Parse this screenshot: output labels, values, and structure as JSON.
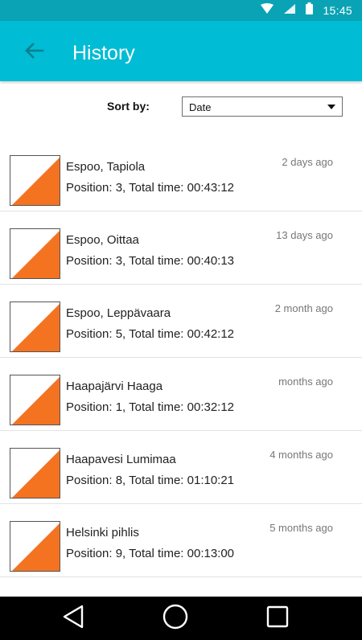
{
  "status_bar": {
    "time": "15:45",
    "icons": [
      "wifi-icon",
      "signal-icon",
      "battery-icon"
    ]
  },
  "app_bar": {
    "title": "History",
    "back_icon": "arrow-left-icon",
    "color": "#00bcd4"
  },
  "sort": {
    "label": "Sort by:",
    "selected": "Date"
  },
  "items": [
    {
      "title": "Espoo, Tapiola",
      "subtitle": "Position: 3, Total time: 00:43:12",
      "time": "2 days ago"
    },
    {
      "title": "Espoo, Oittaa",
      "subtitle": "Position: 3, Total time: 00:40:13",
      "time": "13 days ago"
    },
    {
      "title": "Espoo, Leppävaara",
      "subtitle": "Position: 5, Total time: 00:42:12",
      "time": "2 month ago"
    },
    {
      "title": "Haapajärvi Haaga",
      "subtitle": "Position: 1, Total time: 00:32:12",
      "time": "months ago"
    },
    {
      "title": "Haapavesi Lumimaa",
      "subtitle": "Position: 8, Total time: 01:10:21",
      "time": "4 months ago"
    },
    {
      "title": "Helsinki pihlis",
      "subtitle": "Position: 9, Total time: 00:13:00",
      "time": "5 months ago"
    }
  ],
  "thumb_color": "#f47321",
  "nav_bar": {
    "icons": [
      "back-triangle-icon",
      "home-circle-icon",
      "recents-square-icon"
    ]
  }
}
